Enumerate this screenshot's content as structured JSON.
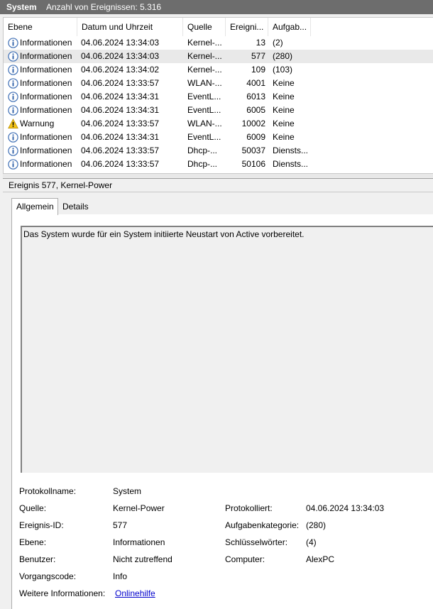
{
  "header": {
    "log_name": "System",
    "event_count": "Anzahl von Ereignissen: 5.316"
  },
  "columns": {
    "level": "Ebene",
    "date": "Datum und Uhrzeit",
    "source": "Quelle",
    "event_id": "Ereigni...",
    "task": "Aufgab..."
  },
  "events": [
    {
      "icon": "info-icon",
      "level": "Informationen",
      "date": "04.06.2024 13:34:03",
      "source": "Kernel-...",
      "event_id": "13",
      "task": "(2)"
    },
    {
      "icon": "info-icon",
      "level": "Informationen",
      "date": "04.06.2024 13:34:03",
      "source": "Kernel-...",
      "event_id": "577",
      "task": "(280)"
    },
    {
      "icon": "info-icon",
      "level": "Informationen",
      "date": "04.06.2024 13:34:02",
      "source": "Kernel-...",
      "event_id": "109",
      "task": "(103)"
    },
    {
      "icon": "info-icon",
      "level": "Informationen",
      "date": "04.06.2024 13:33:57",
      "source": "WLAN-...",
      "event_id": "4001",
      "task": "Keine"
    },
    {
      "icon": "info-icon",
      "level": "Informationen",
      "date": "04.06.2024 13:34:31",
      "source": "EventL...",
      "event_id": "6013",
      "task": "Keine"
    },
    {
      "icon": "info-icon",
      "level": "Informationen",
      "date": "04.06.2024 13:34:31",
      "source": "EventL...",
      "event_id": "6005",
      "task": "Keine"
    },
    {
      "icon": "warning-icon",
      "level": "Warnung",
      "date": "04.06.2024 13:33:57",
      "source": "WLAN-...",
      "event_id": "10002",
      "task": "Keine"
    },
    {
      "icon": "info-icon",
      "level": "Informationen",
      "date": "04.06.2024 13:34:31",
      "source": "EventL...",
      "event_id": "6009",
      "task": "Keine"
    },
    {
      "icon": "info-icon",
      "level": "Informationen",
      "date": "04.06.2024 13:33:57",
      "source": "Dhcp-...",
      "event_id": "50037",
      "task": "Diensts..."
    },
    {
      "icon": "info-icon",
      "level": "Informationen",
      "date": "04.06.2024 13:33:57",
      "source": "Dhcp-...",
      "event_id": "50106",
      "task": "Diensts..."
    }
  ],
  "selected_index": 1,
  "detail": {
    "title": "Ereignis 577, Kernel-Power",
    "tabs": [
      "Allgemein",
      "Details"
    ],
    "message": "Das System wurde für ein System initiierte Neustart von Active vorbereitet.",
    "labels": {
      "log_name": "Protokollname:",
      "source": "Quelle:",
      "event_id": "Ereignis-ID:",
      "level": "Ebene:",
      "user": "Benutzer:",
      "opcode": "Vorgangscode:",
      "more_info": "Weitere Informationen:",
      "logged": "Protokolliert:",
      "task_category": "Aufgabenkategorie:",
      "keywords": "Schlüsselwörter:",
      "computer": "Computer:"
    },
    "values": {
      "log_name": "System",
      "source": "Kernel-Power",
      "event_id": "577",
      "level": "Informationen",
      "user": "Nicht zutreffend",
      "opcode": "Info",
      "more_info": "Onlinehilfe",
      "logged": "04.06.2024 13:34:03",
      "task_category": "(280)",
      "keywords": "(4)",
      "computer": "AlexPC"
    }
  }
}
